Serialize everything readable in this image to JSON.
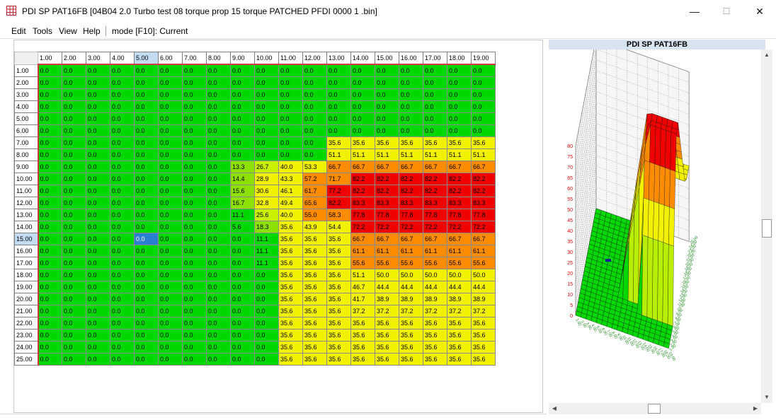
{
  "window": {
    "title": "PDI SP PAT16FB [04B04 2.0 Turbo test 08 torque prop 15 torque PATCHED PFDI 0000 1 .bin]",
    "minimize": "—",
    "maximize": "☐",
    "close": "✕"
  },
  "menu": {
    "items": [
      "Edit",
      "Tools",
      "View",
      "Help"
    ],
    "mode": "mode [F10]: Current"
  },
  "table": {
    "columns": [
      "1.00",
      "2.00",
      "3.00",
      "4.00",
      "5.00",
      "6.00",
      "7.00",
      "8.00",
      "9.00",
      "10.00",
      "11.00",
      "12.00",
      "13.00",
      "14.00",
      "15.00",
      "16.00",
      "17.00",
      "18.00",
      "19.00"
    ],
    "rows": [
      "1.00",
      "2.00",
      "3.00",
      "4.00",
      "5.00",
      "6.00",
      "7.00",
      "8.00",
      "9.00",
      "10.00",
      "11.00",
      "12.00",
      "13.00",
      "14.00",
      "15.00",
      "16.00",
      "17.00",
      "18.00",
      "19.00",
      "20.00",
      "21.00",
      "22.00",
      "23.00",
      "24.00",
      "25.00"
    ],
    "selected_row": 14,
    "selected_col": 4,
    "values": [
      [
        "0.0",
        "0.0",
        "0.0",
        "0.0",
        "0.0",
        "0.0",
        "0.0",
        "0.0",
        "0.0",
        "0.0",
        "0.0",
        "0.0",
        "0.0",
        "0.0",
        "0.0",
        "0.0",
        "0.0",
        "0.0",
        "0.0"
      ],
      [
        "0.0",
        "0.0",
        "0.0",
        "0.0",
        "0.0",
        "0.0",
        "0.0",
        "0.0",
        "0.0",
        "0.0",
        "0.0",
        "0.0",
        "0.0",
        "0.0",
        "0.0",
        "0.0",
        "0.0",
        "0.0",
        "0.0"
      ],
      [
        "0.0",
        "0.0",
        "0.0",
        "0.0",
        "0.0",
        "0.0",
        "0.0",
        "0.0",
        "0.0",
        "0.0",
        "0.0",
        "0.0",
        "0.0",
        "0.0",
        "0.0",
        "0.0",
        "0.0",
        "0.0",
        "0.0"
      ],
      [
        "0.0",
        "0.0",
        "0.0",
        "0.0",
        "0.0",
        "0.0",
        "0.0",
        "0.0",
        "0.0",
        "0.0",
        "0.0",
        "0.0",
        "0.0",
        "0.0",
        "0.0",
        "0.0",
        "0.0",
        "0.0",
        "0.0"
      ],
      [
        "0.0",
        "0.0",
        "0.0",
        "0.0",
        "0.0",
        "0.0",
        "0.0",
        "0.0",
        "0.0",
        "0.0",
        "0.0",
        "0.0",
        "0.0",
        "0.0",
        "0.0",
        "0.0",
        "0.0",
        "0.0",
        "0.0"
      ],
      [
        "0.0",
        "0.0",
        "0.0",
        "0.0",
        "0.0",
        "0.0",
        "0.0",
        "0.0",
        "0.0",
        "0.0",
        "0.0",
        "0.0",
        "0.0",
        "0.0",
        "0.0",
        "0.0",
        "0.0",
        "0.0",
        "0.0"
      ],
      [
        "0.0",
        "0.0",
        "0.0",
        "0.0",
        "0.0",
        "0.0",
        "0.0",
        "0.0",
        "0.0",
        "0.0",
        "0.0",
        "0.0",
        "35.6",
        "35.6",
        "35.6",
        "35.6",
        "35.6",
        "35.6",
        "35.6"
      ],
      [
        "0.0",
        "0.0",
        "0.0",
        "0.0",
        "0.0",
        "0.0",
        "0.0",
        "0.0",
        "0.0",
        "0.0",
        "0.0",
        "0.0",
        "51.1",
        "51.1",
        "51.1",
        "51.1",
        "51.1",
        "51.1",
        "51.1"
      ],
      [
        "0.0",
        "0.0",
        "0.0",
        "0.0",
        "0.0",
        "0.0",
        "0.0",
        "0.0",
        "13.3",
        "26.7",
        "40.0",
        "53.3",
        "66.7",
        "66.7",
        "66.7",
        "66.7",
        "66.7",
        "66.7",
        "66.7"
      ],
      [
        "0.0",
        "0.0",
        "0.0",
        "0.0",
        "0.0",
        "0.0",
        "0.0",
        "0.0",
        "14.4",
        "28.9",
        "43.3",
        "57.2",
        "71.7",
        "82.2",
        "82.2",
        "82.2",
        "82.2",
        "82.2",
        "82.2"
      ],
      [
        "0.0",
        "0.0",
        "0.0",
        "0.0",
        "0.0",
        "0.0",
        "0.0",
        "0.0",
        "15.6",
        "30.6",
        "46.1",
        "61.7",
        "77.2",
        "82.2",
        "82.2",
        "82.2",
        "82.2",
        "82.2",
        "82.2"
      ],
      [
        "0.0",
        "0.0",
        "0.0",
        "0.0",
        "0.0",
        "0.0",
        "0.0",
        "0.0",
        "16.7",
        "32.8",
        "49.4",
        "65.6",
        "82.2",
        "83.3",
        "83.3",
        "83.3",
        "83.3",
        "83.3",
        "83.3"
      ],
      [
        "0.0",
        "0.0",
        "0.0",
        "0.0",
        "0.0",
        "0.0",
        "0.0",
        "0.0",
        "11.1",
        "25.6",
        "40.0",
        "55.0",
        "58.3",
        "77.8",
        "77.8",
        "77.8",
        "77.8",
        "77.8",
        "77.8"
      ],
      [
        "0.0",
        "0.0",
        "0.0",
        "0.0",
        "0.0",
        "0.0",
        "0.0",
        "0.0",
        "5.6",
        "18.3",
        "35.6",
        "43.9",
        "54.4",
        "72.2",
        "72.2",
        "72.2",
        "72.2",
        "72.2",
        "72.2"
      ],
      [
        "0.0",
        "0.0",
        "0.0",
        "0.0",
        "0.0",
        "0.0",
        "0.0",
        "0.0",
        "0.0",
        "11.1",
        "35.6",
        "35.6",
        "35.6",
        "66.7",
        "66.7",
        "66.7",
        "66.7",
        "66.7",
        "66.7"
      ],
      [
        "0.0",
        "0.0",
        "0.0",
        "0.0",
        "0.0",
        "0.0",
        "0.0",
        "0.0",
        "0.0",
        "11.1",
        "35.6",
        "35.6",
        "35.6",
        "61.1",
        "61.1",
        "61.1",
        "61.1",
        "61.1",
        "61.1"
      ],
      [
        "0.0",
        "0.0",
        "0.0",
        "0.0",
        "0.0",
        "0.0",
        "0.0",
        "0.0",
        "0.0",
        "11.1",
        "35.6",
        "35.6",
        "35.6",
        "55.6",
        "55.6",
        "55.6",
        "55.6",
        "55.6",
        "55.6"
      ],
      [
        "0.0",
        "0.0",
        "0.0",
        "0.0",
        "0.0",
        "0.0",
        "0.0",
        "0.0",
        "0.0",
        "0.0",
        "35.6",
        "35.6",
        "35.6",
        "51.1",
        "50.0",
        "50.0",
        "50.0",
        "50.0",
        "50.0"
      ],
      [
        "0.0",
        "0.0",
        "0.0",
        "0.0",
        "0.0",
        "0.0",
        "0.0",
        "0.0",
        "0.0",
        "0.0",
        "35.6",
        "35.6",
        "35.6",
        "46.7",
        "44.4",
        "44.4",
        "44.4",
        "44.4",
        "44.4"
      ],
      [
        "0.0",
        "0.0",
        "0.0",
        "0.0",
        "0.0",
        "0.0",
        "0.0",
        "0.0",
        "0.0",
        "0.0",
        "35.6",
        "35.6",
        "35.6",
        "41.7",
        "38.9",
        "38.9",
        "38.9",
        "38.9",
        "38.9"
      ],
      [
        "0.0",
        "0.0",
        "0.0",
        "0.0",
        "0.0",
        "0.0",
        "0.0",
        "0.0",
        "0.0",
        "0.0",
        "35.6",
        "35.6",
        "35.6",
        "37.2",
        "37.2",
        "37.2",
        "37.2",
        "37.2",
        "37.2"
      ],
      [
        "0.0",
        "0.0",
        "0.0",
        "0.0",
        "0.0",
        "0.0",
        "0.0",
        "0.0",
        "0.0",
        "0.0",
        "35.6",
        "35.6",
        "35.6",
        "35.6",
        "35.6",
        "35.6",
        "35.6",
        "35.6",
        "35.6"
      ],
      [
        "0.0",
        "0.0",
        "0.0",
        "0.0",
        "0.0",
        "0.0",
        "0.0",
        "0.0",
        "0.0",
        "0.0",
        "35.6",
        "35.6",
        "35.6",
        "35.6",
        "35.6",
        "35.6",
        "35.6",
        "35.6",
        "35.6"
      ],
      [
        "0.0",
        "0.0",
        "0.0",
        "0.0",
        "0.0",
        "0.0",
        "0.0",
        "0.0",
        "0.0",
        "0.0",
        "35.6",
        "35.6",
        "35.6",
        "35.6",
        "35.6",
        "35.6",
        "35.6",
        "35.6",
        "35.6"
      ],
      [
        "0.0",
        "0.0",
        "0.0",
        "0.0",
        "0.0",
        "0.0",
        "0.0",
        "0.0",
        "0.0",
        "0.0",
        "35.6",
        "35.6",
        "35.6",
        "35.6",
        "35.6",
        "35.6",
        "35.6",
        "35.6",
        "35.6"
      ]
    ]
  },
  "plot": {
    "title": "PDI SP PAT16FB",
    "z_ticks": [
      "80",
      "75",
      "70",
      "65",
      "60",
      "55",
      "50",
      "45",
      "40",
      "35",
      "30",
      "25",
      "20",
      "15",
      "10",
      "5",
      "0"
    ]
  },
  "colors": {
    "low": "#00d800",
    "yellow": "#f2f200",
    "orange": "#ff8c00",
    "red": "#f00000",
    "selected": "#2a7fd0",
    "header_accent": "#d0384a"
  },
  "icons": {
    "app": "grid-table-icon",
    "scroll_up": "▲",
    "scroll_down": "▼",
    "scroll_left": "◀",
    "scroll_right": "▶"
  }
}
